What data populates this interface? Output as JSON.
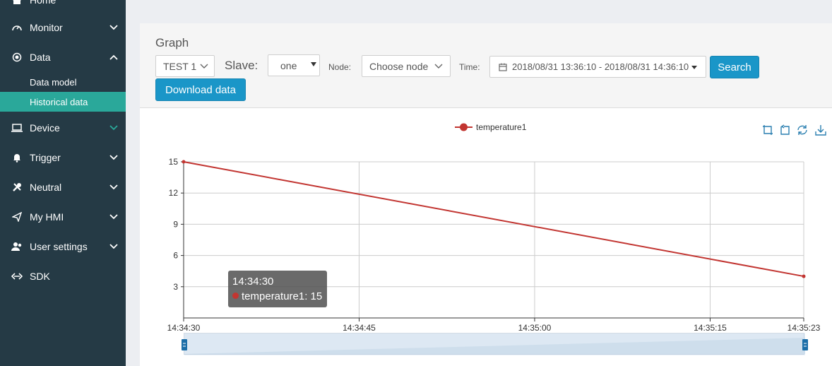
{
  "sidebar": {
    "items": [
      {
        "label": "Home",
        "icon": "home-icon"
      },
      {
        "label": "Monitor",
        "icon": "gauge-icon"
      },
      {
        "label": "Data",
        "icon": "record-icon"
      },
      {
        "label": "Device",
        "icon": "laptop-icon"
      },
      {
        "label": "Trigger",
        "icon": "bell-icon"
      },
      {
        "label": "Neutral",
        "icon": "wrench-icon"
      },
      {
        "label": "My HMI",
        "icon": "paper-plane-icon"
      },
      {
        "label": "User settings",
        "icon": "users-icon"
      },
      {
        "label": "SDK",
        "icon": "code-arrows-icon"
      }
    ],
    "data_sub": {
      "data_model": "Data model",
      "historical_data": "Historical data"
    },
    "active_color": "#2aa89a"
  },
  "graph": {
    "title": "Graph",
    "test_select": "TEST 1",
    "slave_label": "Slave:",
    "slave_select": "one",
    "node_label": "Node:",
    "node_select": "Choose node",
    "time_label": "Time:",
    "time_range": "2018/08/31 13:36:10 - 2018/08/31 14:36:10",
    "search_button": "Search",
    "download_button": "Download data",
    "button_color": "#1a96c8"
  },
  "chart_data": {
    "type": "line",
    "series": [
      {
        "name": "temperature1",
        "color": "#c23531",
        "x": [
          "14:34:30",
          "14:35:23"
        ],
        "values": [
          15,
          4
        ]
      }
    ],
    "x_ticks": [
      "14:34:30",
      "14:34:45",
      "14:35:00",
      "14:35:15",
      "14:35:23"
    ],
    "y_ticks": [
      15,
      12,
      9,
      6,
      3
    ],
    "ylim": [
      0,
      15
    ],
    "legend_position": "top-center",
    "grid": true,
    "tooltip": {
      "time": "14:34:30",
      "text": "temperature1: 15"
    }
  }
}
